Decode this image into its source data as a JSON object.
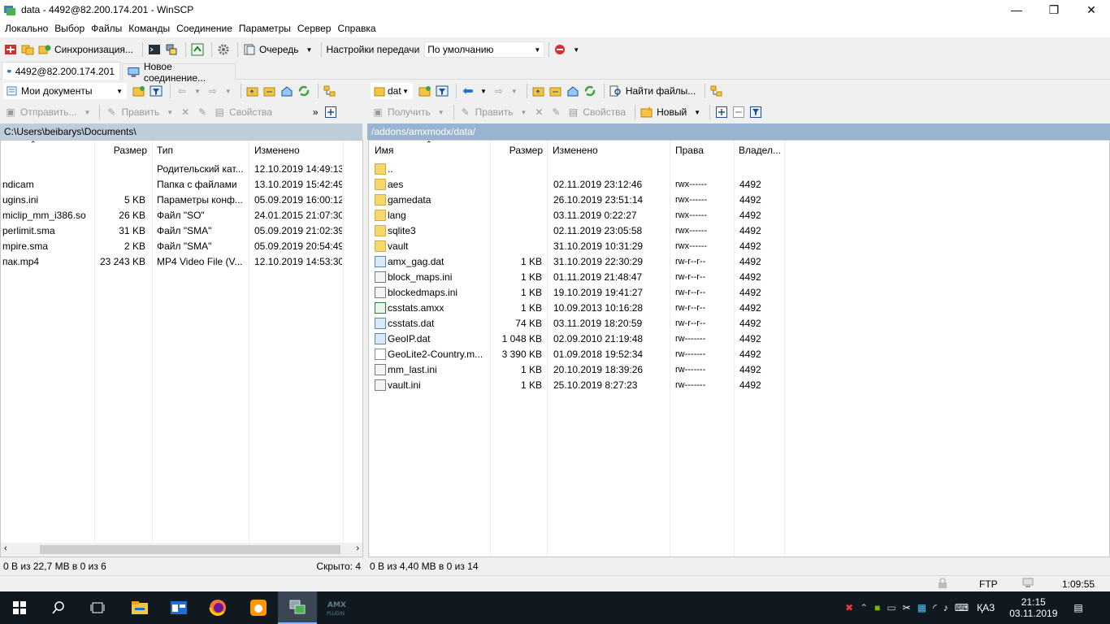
{
  "window": {
    "title": "data - 4492@82.200.174.201 - WinSCP",
    "minimize": "—",
    "maximize": "❐",
    "close": "✕"
  },
  "menu": [
    "Локально",
    "Выбор",
    "Файлы",
    "Команды",
    "Соединение",
    "Параметры",
    "Сервер",
    "Справка"
  ],
  "toolbar": {
    "sync_label": "Синхронизация...",
    "queue_label": "Очередь",
    "transfer_settings_label": "Настройки передачи",
    "transfer_preset": "По умолчанию"
  },
  "tabs": {
    "active": "4492@82.200.174.201",
    "new": "Новое соединение..."
  },
  "local": {
    "drive": "Мои документы",
    "send_label": "Отправить...",
    "edit_label": "Править",
    "props_label": "Свойства",
    "path": "C:\\Users\\beibarys\\Documents\\",
    "columns": {
      "size": "Размер",
      "type": "Тип",
      "modified": "Изменено"
    },
    "rows": [
      {
        "name": "",
        "size": "",
        "type": "Родительский кат...",
        "modified": "12.10.2019  14:49:13"
      },
      {
        "name": "ndicam",
        "size": "",
        "type": "Папка с файлами",
        "modified": "13.10.2019  15:42:49"
      },
      {
        "name": "ugins.ini",
        "size": "5 KB",
        "type": "Параметры конф...",
        "modified": "05.09.2019  16:00:12"
      },
      {
        "name": "miclip_mm_i386.so",
        "size": "26 KB",
        "type": "Файл \"SO\"",
        "modified": "24.01.2015  21:07:30"
      },
      {
        "name": "perlimit.sma",
        "size": "31 KB",
        "type": "Файл \"SMA\"",
        "modified": "05.09.2019  21:02:39"
      },
      {
        "name": "mpire.sma",
        "size": "2 KB",
        "type": "Файл \"SMA\"",
        "modified": "05.09.2019  20:54:49"
      },
      {
        "name": "пак.mp4",
        "size": "23 243 KB",
        "type": "MP4 Video File (V...",
        "modified": "12.10.2019  14:53:30"
      }
    ],
    "status": "0 B из 22,7 MB в 0 из 6",
    "hidden": "Скрыто: 4"
  },
  "remote": {
    "dir": "dat",
    "find_label": "Найти файлы...",
    "get_label": "Получить",
    "edit_label": "Править",
    "props_label": "Свойства",
    "new_label": "Новый",
    "path": "/addons/amxmodx/data/",
    "columns": {
      "name": "Имя",
      "size": "Размер",
      "modified": "Изменено",
      "rights": "Права",
      "owner": "Владел..."
    },
    "rows": [
      {
        "name": "..",
        "size": "",
        "modified": "",
        "rights": "",
        "owner": "",
        "icon": "up-folder"
      },
      {
        "name": "aes",
        "size": "",
        "modified": "02.11.2019 23:12:46",
        "rights": "rwx------",
        "owner": "4492",
        "icon": "folder"
      },
      {
        "name": "gamedata",
        "size": "",
        "modified": "26.10.2019 23:51:14",
        "rights": "rwx------",
        "owner": "4492",
        "icon": "folder"
      },
      {
        "name": "lang",
        "size": "",
        "modified": "03.11.2019 0:22:27",
        "rights": "rwx------",
        "owner": "4492",
        "icon": "folder"
      },
      {
        "name": "sqlite3",
        "size": "",
        "modified": "02.11.2019 23:05:58",
        "rights": "rwx------",
        "owner": "4492",
        "icon": "folder"
      },
      {
        "name": "vault",
        "size": "",
        "modified": "31.10.2019 10:31:29",
        "rights": "rwx------",
        "owner": "4492",
        "icon": "folder"
      },
      {
        "name": "amx_gag.dat",
        "size": "1 KB",
        "modified": "31.10.2019 22:30:29",
        "rights": "rw-r--r--",
        "owner": "4492",
        "icon": "dat"
      },
      {
        "name": "block_maps.ini",
        "size": "1 KB",
        "modified": "01.11.2019 21:48:47",
        "rights": "rw-r--r--",
        "owner": "4492",
        "icon": "ini"
      },
      {
        "name": "blockedmaps.ini",
        "size": "1 KB",
        "modified": "19.10.2019 19:41:27",
        "rights": "rw-r--r--",
        "owner": "4492",
        "icon": "ini"
      },
      {
        "name": "csstats.amxx",
        "size": "1 KB",
        "modified": "10.09.2013 10:16:28",
        "rights": "rw-r--r--",
        "owner": "4492",
        "icon": "amxx"
      },
      {
        "name": "csstats.dat",
        "size": "74 KB",
        "modified": "03.11.2019 18:20:59",
        "rights": "rw-r--r--",
        "owner": "4492",
        "icon": "dat"
      },
      {
        "name": "GeoIP.dat",
        "size": "1 048 KB",
        "modified": "02.09.2010 21:19:48",
        "rights": "rw-------",
        "owner": "4492",
        "icon": "dat"
      },
      {
        "name": "GeoLite2-Country.m...",
        "size": "3 390 KB",
        "modified": "01.09.2018 19:52:34",
        "rights": "rw-------",
        "owner": "4492",
        "icon": "file"
      },
      {
        "name": "mm_last.ini",
        "size": "1 KB",
        "modified": "20.10.2019 18:39:26",
        "rights": "rw-------",
        "owner": "4492",
        "icon": "ini"
      },
      {
        "name": "vault.ini",
        "size": "1 KB",
        "modified": "25.10.2019 8:27:23",
        "rights": "rw-------",
        "owner": "4492",
        "icon": "ini"
      }
    ],
    "status": "0 B из 4,40 MB в 0 из 14"
  },
  "bottom": {
    "protocol": "FTP",
    "elapsed": "1:09:55"
  },
  "taskbar": {
    "lang": "ҚАЗ",
    "time": "21:15",
    "date": "03.11.2019"
  }
}
